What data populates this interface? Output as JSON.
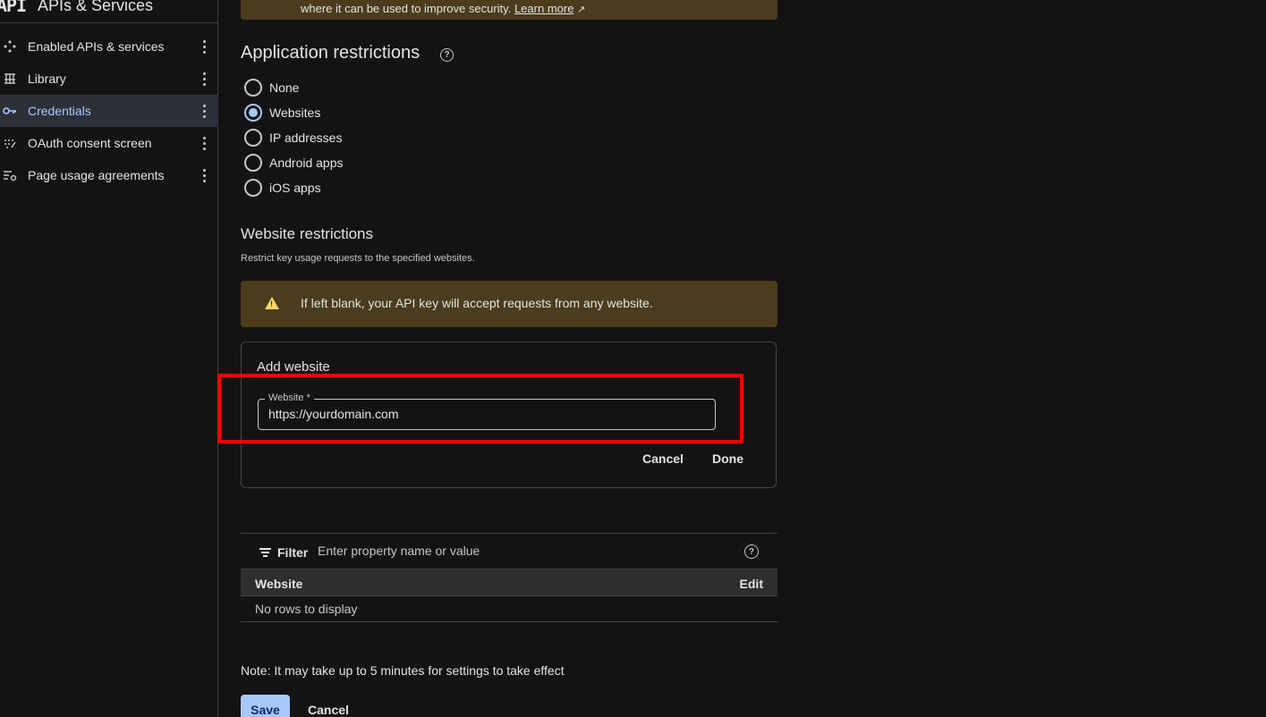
{
  "sidebar": {
    "logo": "API",
    "title": "APIs & Services",
    "items": [
      {
        "label": "Enabled APIs & services",
        "icon": "enabled-apis-icon",
        "active": false
      },
      {
        "label": "Library",
        "icon": "library-icon",
        "active": false
      },
      {
        "label": "Credentials",
        "icon": "key-icon",
        "active": true
      },
      {
        "label": "OAuth consent screen",
        "icon": "oauth-icon",
        "active": false
      },
      {
        "label": "Page usage agreements",
        "icon": "settings-list-icon",
        "active": false
      }
    ]
  },
  "top_banner": {
    "text": "where it can be used to improve security.",
    "link": "Learn more"
  },
  "app_restrictions": {
    "heading": "Application restrictions",
    "options": [
      "None",
      "Websites",
      "IP addresses",
      "Android apps",
      "iOS apps"
    ],
    "selected": "Websites"
  },
  "website_restrictions": {
    "heading": "Website restrictions",
    "subtitle": "Restrict key usage requests to the specified websites.",
    "warning": "If left blank, your API key will accept requests from any website."
  },
  "add_website": {
    "title": "Add website",
    "field_label": "Website *",
    "field_value": "https://yourdomain.com",
    "cancel_label": "Cancel",
    "done_label": "Done"
  },
  "filter": {
    "label": "Filter",
    "placeholder": "Enter property name or value"
  },
  "table": {
    "columns": [
      "Website",
      "Edit"
    ],
    "empty_text": "No rows to display"
  },
  "footer": {
    "note": "Note: It may take up to 5 minutes for settings to take effect",
    "save_label": "Save",
    "cancel_label": "Cancel"
  },
  "colors": {
    "accent": "#a8c7fa",
    "warning_bg": "#4a3c1c",
    "highlight": "#ff0000"
  }
}
